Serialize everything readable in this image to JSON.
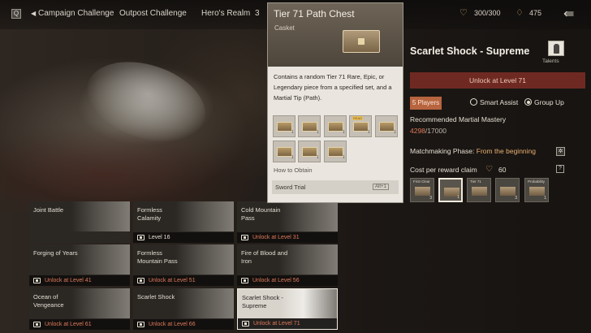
{
  "topbar": {
    "q_label": "Q",
    "tabs": [
      "Campaign Challenge",
      "Outpost Challenge",
      "Hero's Realm",
      "3"
    ],
    "stamina": "300/300",
    "currency": "475"
  },
  "tooltip": {
    "title": "Tier 71 Path Chest",
    "subtitle": "Casket",
    "description": "Contains a random Tier 71 Rare, Epic, or Legendary piece from a specified set, and a Martial Tip (Path).",
    "read_badge": "READ",
    "item_counts": [
      "1",
      "1",
      "1",
      "1",
      "1",
      "1",
      "1",
      "1"
    ],
    "how_to_obtain": "How to Obtain",
    "source": "Sword Trial",
    "source_key": "Alt+1"
  },
  "panel": {
    "title": "Scarlet Shock - Supreme",
    "talents_label": "Talents",
    "unlock_text": "Unlock at Level 71",
    "players_label": "5 Players",
    "smart_assist_label": "Smart Assist",
    "group_up_label": "Group Up",
    "group_up_selected": true,
    "mastery_label": "Recommended Martial Mastery",
    "mastery_current": "4298",
    "mastery_required": "/17000",
    "phase_label": "Matchmaking Phase:",
    "phase_value": "From the beginning",
    "cost_label": "Cost per reward claim",
    "cost_value": "60",
    "rewards": [
      {
        "label": "First Clear",
        "count": "3",
        "selected": false
      },
      {
        "label": "",
        "count": "1",
        "selected": true
      },
      {
        "label": "Tier 71",
        "count": "",
        "selected": false
      },
      {
        "label": "",
        "count": "3",
        "selected": false
      },
      {
        "label": "Probability",
        "count": "1",
        "selected": false
      }
    ]
  },
  "stages": [
    {
      "name": "Joint Battle",
      "status": "",
      "locked": false,
      "selected": false
    },
    {
      "name": "Formless Calamity",
      "status": "Level 16",
      "locked": false,
      "selected": false
    },
    {
      "name": "Cold Mountain Pass",
      "status": "Unlock at Level 31",
      "locked": true,
      "selected": false
    },
    {
      "name": "Forging of Years",
      "status": "Unlock at Level 41",
      "locked": true,
      "selected": false
    },
    {
      "name": "Formless Mountain Pass",
      "status": "Unlock at Level 51",
      "locked": true,
      "selected": false
    },
    {
      "name": "Fire of Blood and Iron",
      "status": "Unlock at Level 56",
      "locked": true,
      "selected": false
    },
    {
      "name": "Ocean of Vengeance",
      "status": "Unlock at Level 61",
      "locked": true,
      "selected": false
    },
    {
      "name": "Scarlet Shock",
      "status": "Unlock at Level 66",
      "locked": true,
      "selected": false
    },
    {
      "name": "Scarlet Shock - Supreme",
      "status": "Unlock at Level 71",
      "locked": true,
      "selected": true
    }
  ],
  "colors": {
    "accent_red": "#6e2a22",
    "lock_text": "#e07a5c",
    "players_badge": "#b7643f",
    "phase_value": "#e8b070"
  },
  "icons": [
    "search-icon",
    "back-chevron-icon",
    "heart-icon",
    "gem-icon",
    "exit-icon",
    "talents-icon",
    "settings-icon",
    "help-icon",
    "chest-icon",
    "lock-icon"
  ]
}
